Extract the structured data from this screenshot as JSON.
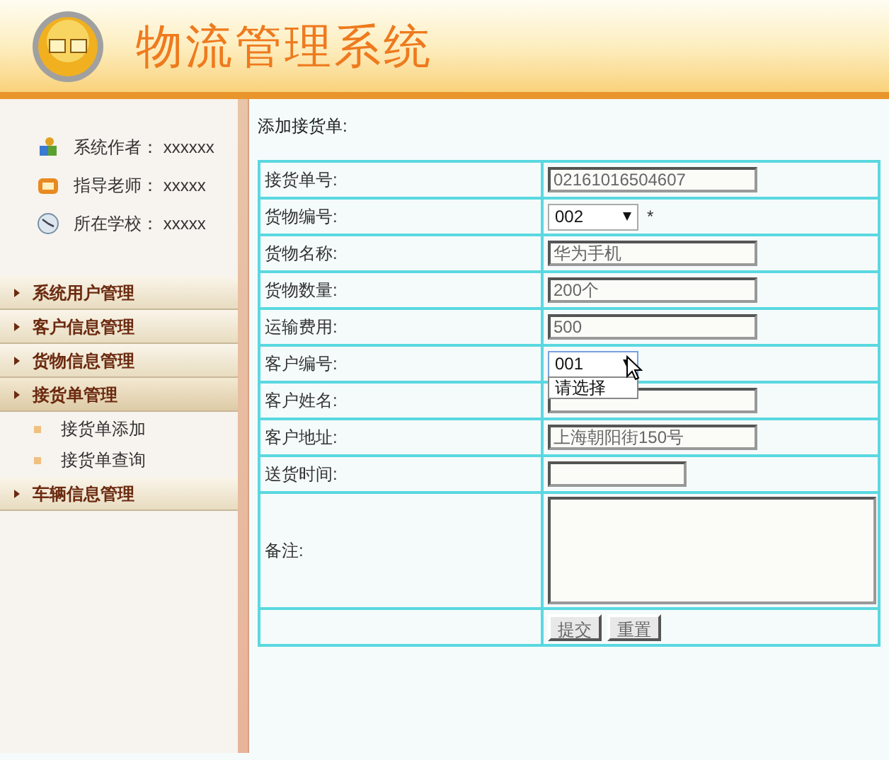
{
  "header": {
    "title": "物流管理系统"
  },
  "sidebar": {
    "info": [
      {
        "kind": "author",
        "label": "系统作者：",
        "value": "xxxxxx"
      },
      {
        "kind": "teacher",
        "label": "指导老师：",
        "value": "xxxxx"
      },
      {
        "kind": "school",
        "label": "所在学校：",
        "value": "xxxxx"
      }
    ],
    "menus": [
      {
        "label": "系统用户管理",
        "expanded": false
      },
      {
        "label": "客户信息管理",
        "expanded": false
      },
      {
        "label": "货物信息管理",
        "expanded": false
      },
      {
        "label": "接货单管理",
        "expanded": true,
        "children": [
          {
            "label": "接货单添加"
          },
          {
            "label": "接货单查询"
          }
        ]
      },
      {
        "label": "车辆信息管理",
        "expanded": false
      }
    ]
  },
  "form": {
    "title": "添加接货单:",
    "rows": [
      {
        "kind": "text",
        "label": "接货单号:",
        "value": "02161016504607"
      },
      {
        "kind": "select",
        "label": "货物编号:",
        "value": "002",
        "required_mark": "*",
        "open": false
      },
      {
        "kind": "text",
        "label": "货物名称:",
        "value": "华为手机"
      },
      {
        "kind": "text",
        "label": "货物数量:",
        "value": "200个"
      },
      {
        "kind": "text",
        "label": "运输费用:",
        "value": "500"
      },
      {
        "kind": "select",
        "label": "客户编号:",
        "value": "001",
        "open": true,
        "options": [
          "请选择"
        ]
      },
      {
        "kind": "text",
        "label": "客户姓名:"
      },
      {
        "kind": "text",
        "label": "客户地址:",
        "value": "上海朝阳街150号"
      },
      {
        "kind": "short",
        "label": "送货时间:"
      },
      {
        "kind": "textarea",
        "label": "备注:"
      },
      {
        "kind": "buttons",
        "buttons": [
          "提交",
          "重置"
        ]
      }
    ]
  }
}
